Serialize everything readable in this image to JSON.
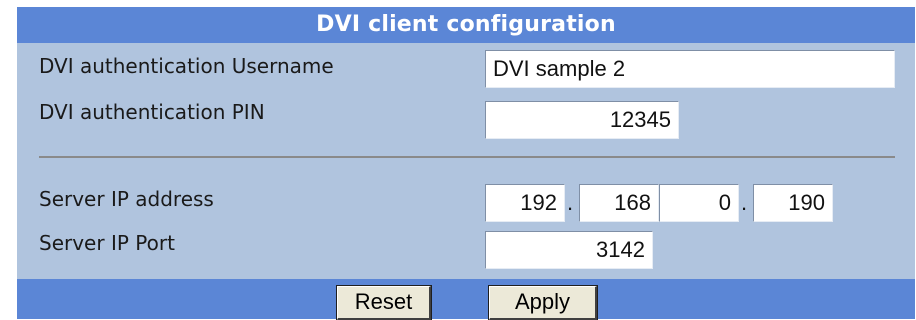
{
  "title": "DVI client configuration",
  "fields": {
    "username": {
      "label": "DVI authentication Username",
      "value": "DVI sample 2"
    },
    "pin": {
      "label": "DVI authentication PIN",
      "value": "12345"
    },
    "server_ip": {
      "label": "Server IP address",
      "octets": [
        "192",
        "168",
        "0",
        "190"
      ],
      "separator": "."
    },
    "server_port": {
      "label": "Server IP Port",
      "value": "3142"
    }
  },
  "buttons": {
    "reset": "Reset",
    "apply": "Apply"
  },
  "colors": {
    "panel_bg": "#b0c4de",
    "title_bg": "#5b86d6",
    "title_text": "#ffffff"
  }
}
